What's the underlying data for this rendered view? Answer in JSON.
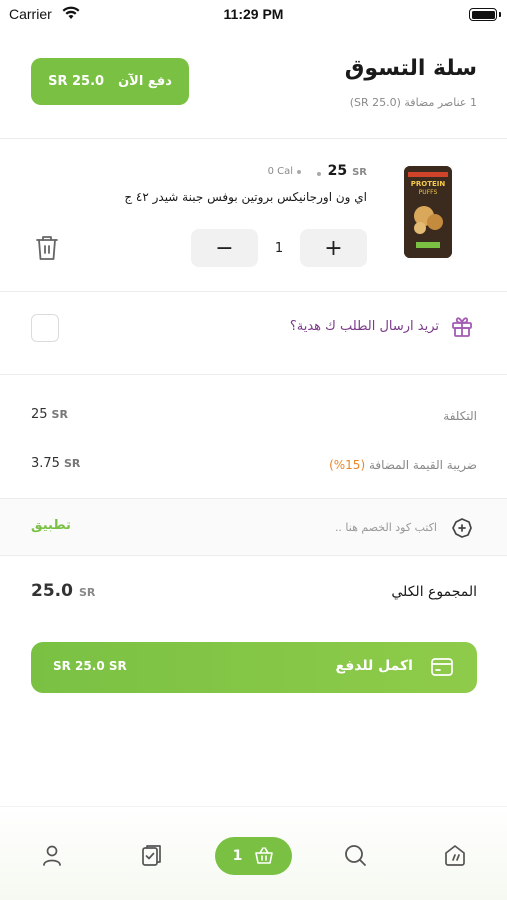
{
  "status_bar": {
    "carrier": "Carrier",
    "time": "11:29 PM"
  },
  "header": {
    "title": "سلة التسوق",
    "subtitle": "1 عناصر مضافة  (SR 25.0)",
    "pay_now_label": "دفع الآن",
    "pay_now_amount": "SR 25.0"
  },
  "product": {
    "price": "25",
    "price_currency": "SR",
    "calories": "0 Cal",
    "name": "اي ون اورجانيكس  بروتين بوفس جبنة شيدر ٤٢ ج",
    "quantity": "1",
    "minus": "−",
    "plus": "+",
    "image_label_top": "PROTEIN",
    "image_label_bottom": "PUFFS"
  },
  "gift": {
    "label": "تريد ارسال الطلب ك هدية؟",
    "checked": false
  },
  "summary": {
    "cost_label": "التكلفة",
    "cost_value": "25",
    "vat_label": "ضريبة القيمة المضافة",
    "vat_pct": "(15%)",
    "vat_value": "3.75",
    "currency": "SR"
  },
  "coupon": {
    "placeholder": "اكتب كود الخصم هنا ..",
    "apply_label": "تطبيق"
  },
  "total": {
    "label": "المجموع الكلي",
    "value": "25.0",
    "currency": "SR"
  },
  "checkout": {
    "label": "اكمل للدفع",
    "amount": "SR 25.0  SR"
  },
  "bottom_nav": {
    "cart_count": "1"
  },
  "colors": {
    "accent": "#7ac143",
    "gift_text": "#7b3b8a",
    "vat_pct": "#e8862a"
  },
  "icons": [
    "wifi-icon",
    "battery-icon",
    "trash-icon",
    "gift-icon",
    "coupon-icon",
    "card-icon",
    "profile-icon",
    "orders-icon",
    "basket-icon",
    "search-icon",
    "home-icon"
  ]
}
